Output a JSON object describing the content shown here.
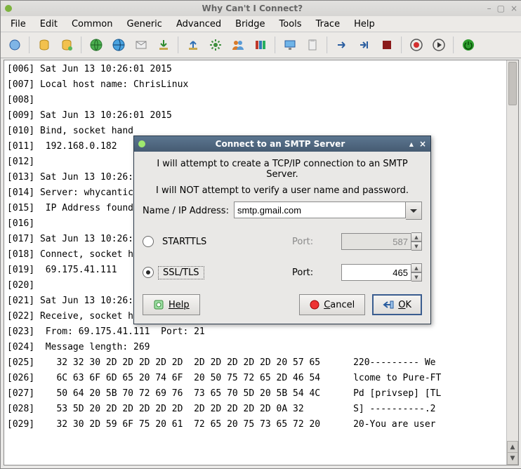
{
  "window": {
    "title": "Why Can't I Connect?"
  },
  "menu": [
    "File",
    "Edit",
    "Common",
    "Generic",
    "Advanced",
    "Bridge",
    "Tools",
    "Trace",
    "Help"
  ],
  "log_lines": [
    "[006] Sat Jun 13 10:26:01 2015",
    "[007] Local host name: ChrisLinux",
    "[008]",
    "[009] Sat Jun 13 10:26:01 2015",
    "[010] Bind, socket hand",
    "[011]  192.168.0.182",
    "[012]",
    "[013] Sat Jun 13 10:26:0",
    "[014] Server: whycantic",
    "[015]  IP Address found",
    "[016]",
    "[017] Sat Jun 13 10:26:0",
    "[018] Connect, socket h",
    "[019]  69.175.41.111",
    "[020]",
    "[021] Sat Jun 13 10:26:",
    "[022] Receive, socket h",
    "[023]  From: 69.175.41.111  Port: 21",
    "[024]  Message length: 269",
    "[025]    32 32 30 2D 2D 2D 2D 2D  2D 2D 2D 2D 2D 20 57 65      220--------- We",
    "[026]    6C 63 6F 6D 65 20 74 6F  20 50 75 72 65 2D 46 54      lcome to Pure-FT",
    "[027]    50 64 20 5B 70 72 69 76  73 65 70 5D 20 5B 54 4C      Pd [privsep] [TL",
    "[028]    53 5D 20 2D 2D 2D 2D 2D  2D 2D 2D 2D 2D 0A 32         S] ----------.2",
    "[029]    32 30 2D 59 6F 75 20 61  72 65 20 75 73 65 72 20      20-You are user"
  ],
  "dialog": {
    "title": "Connect to an SMTP Server",
    "intro1": "I will attempt to create a TCP/IP connection to an SMTP Server.",
    "intro2": "I will NOT attempt to verify a user name and password.",
    "addr_label": "Name / IP Address:",
    "addr_value": "smtp.gmail.com",
    "opt_starttls": "STARTTLS",
    "opt_ssltls": "SSL/TLS",
    "port_label": "Port:",
    "port_starttls": "587",
    "port_ssltls": "465",
    "help": "Help",
    "cancel": "Cancel",
    "ok": "OK"
  }
}
